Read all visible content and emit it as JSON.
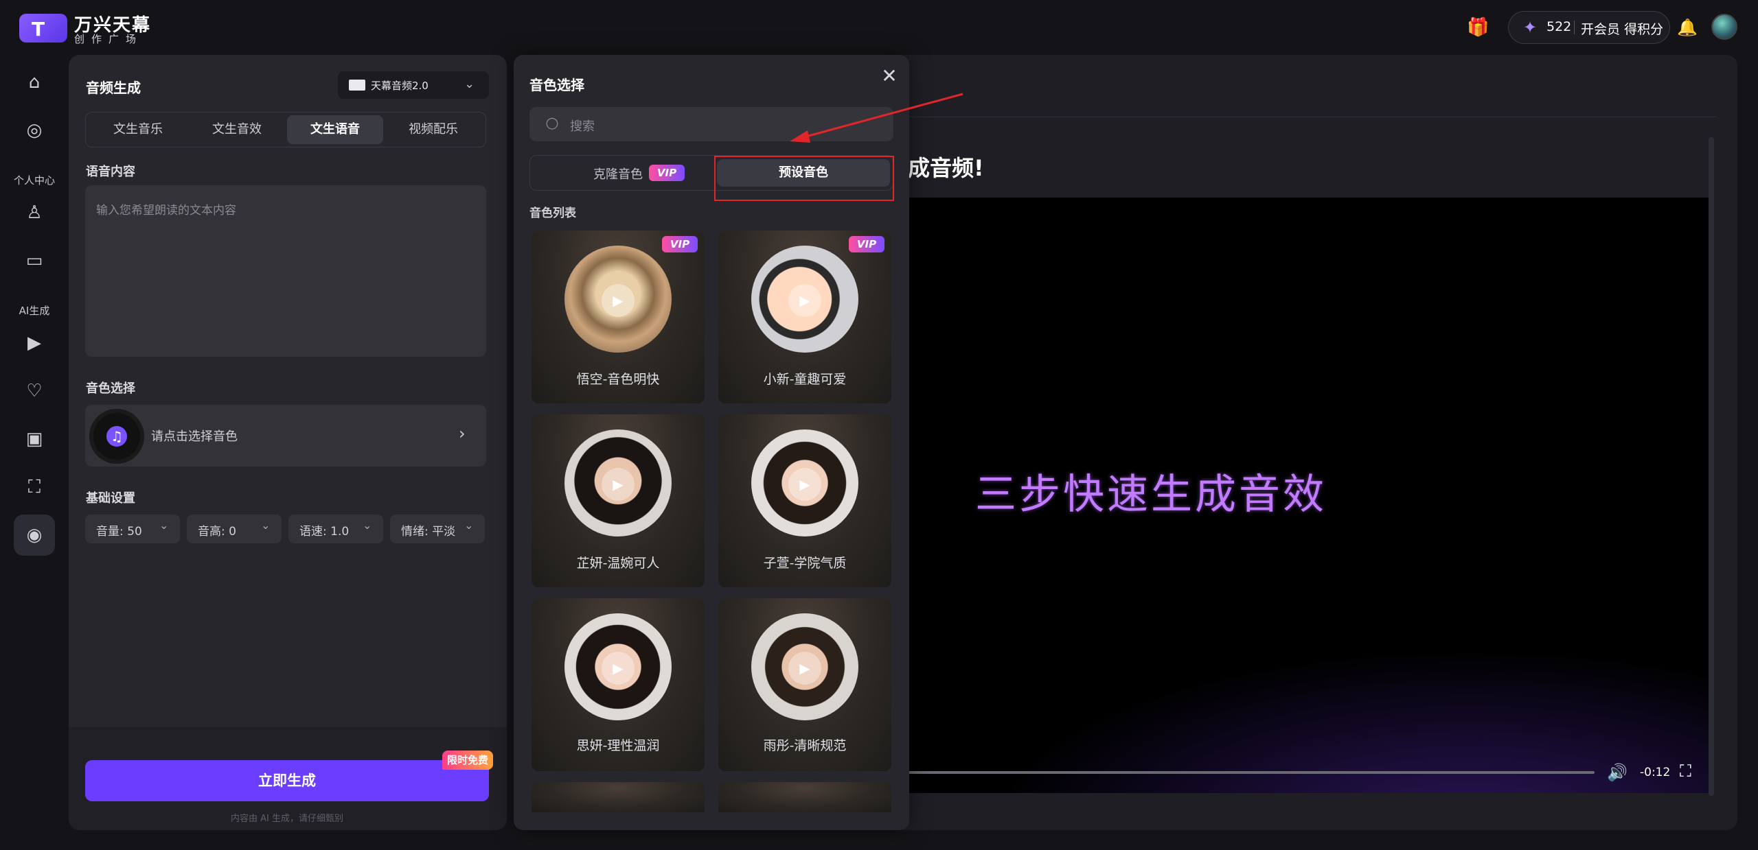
{
  "brand": {
    "title": "万兴天幕",
    "subtitle": "创作广场",
    "mark": "T"
  },
  "header": {
    "gift_icon": "gift-icon",
    "points": "522",
    "points_link": "开会员 得积分",
    "bell_icon": "bell-icon"
  },
  "left_nav": {
    "items": [
      {
        "icon": "home-icon",
        "glyph": "⌂"
      },
      {
        "icon": "compass-icon",
        "glyph": "◎"
      },
      {
        "icon": "user-icon",
        "glyph": "♙"
      },
      {
        "icon": "folder-icon",
        "glyph": "▭"
      },
      {
        "icon": "video-icon",
        "glyph": "▶"
      },
      {
        "icon": "heart-image-icon",
        "glyph": "♡"
      },
      {
        "icon": "image-edit-icon",
        "glyph": "▣"
      },
      {
        "icon": "picture-icon",
        "glyph": "⛶"
      },
      {
        "icon": "music-disc-icon",
        "glyph": "◉"
      }
    ],
    "section_personal": "个人中心",
    "section_ai": "AI生成"
  },
  "panel": {
    "title": "音频生成",
    "model": "天幕音频2.0",
    "tabs": [
      "文生音乐",
      "文生音效",
      "文生语音",
      "视频配乐"
    ],
    "active_tab": "文生语音",
    "content_label": "语音内容",
    "content_placeholder": "输入您希望朗读的文本内容",
    "voice_label": "音色选择",
    "voice_placeholder": "请点击选择音色",
    "settings_label": "基础设置",
    "settings": [
      "音量: 50",
      "音高: 0",
      "语速: 1.0",
      "情绪: 平淡"
    ],
    "generate_label": "立即生成",
    "free_badge": "限时免费",
    "disclaimer": "内容由 AI 生成，请仔细甄别"
  },
  "main": {
    "headline": "成音频!",
    "video_text": "三步快速生成音效",
    "time": "-0:12"
  },
  "modal": {
    "title": "音色选择",
    "search_placeholder": "搜索",
    "seg_clone": "克隆音色",
    "seg_preset": "预设音色",
    "vip": "VIP",
    "list_label": "音色列表",
    "voices": [
      {
        "name": "悟空-音色明快",
        "vip": true
      },
      {
        "name": "小新-童趣可爱",
        "vip": true
      },
      {
        "name": "芷妍-温婉可人",
        "vip": false
      },
      {
        "name": "子萱-学院气质",
        "vip": false
      },
      {
        "name": "思妍-理性温润",
        "vip": false
      },
      {
        "name": "雨彤-清晰规范",
        "vip": false
      }
    ]
  },
  "colors": {
    "accent": "#6a3dff",
    "highlight": "#e0262a",
    "vip_from": "#ff4fa0",
    "vip_to": "#7b4dff"
  }
}
